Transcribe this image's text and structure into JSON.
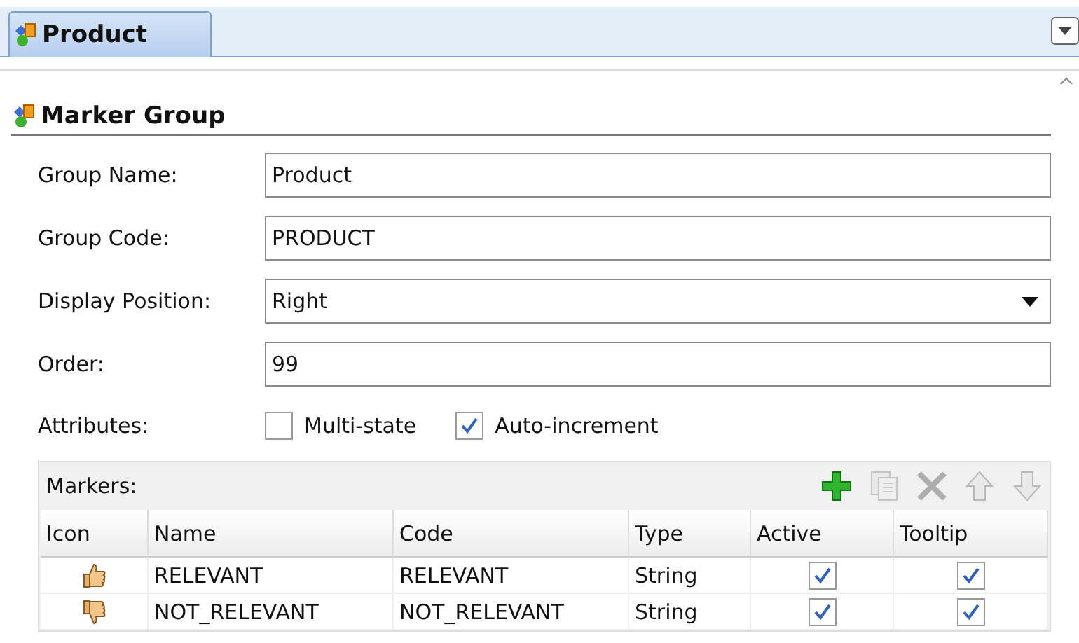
{
  "tab": {
    "label": "Product",
    "selected": true
  },
  "section": {
    "title": "Marker Group"
  },
  "fields": [
    {
      "label": "Group Name:",
      "value": "Product",
      "kind": "text"
    },
    {
      "label": "Group Code:",
      "value": "PRODUCT",
      "kind": "text"
    },
    {
      "label": "Display Position:",
      "value": "Right",
      "kind": "select"
    },
    {
      "label": "Order:",
      "value": "99",
      "kind": "text"
    }
  ],
  "attributes": {
    "label": "Attributes:",
    "options": [
      {
        "label": "Multi-state",
        "checked": false
      },
      {
        "label": "Auto-increment",
        "checked": true
      }
    ]
  },
  "markers": {
    "title": "Markers:",
    "toolbar": [
      {
        "kind": "add",
        "disabled": false
      },
      {
        "kind": "copy",
        "disabled": true
      },
      {
        "kind": "delete",
        "disabled": true
      },
      {
        "kind": "up",
        "disabled": true
      },
      {
        "kind": "down",
        "disabled": true
      }
    ],
    "columns": [
      "Icon",
      "Name",
      "Code",
      "Type",
      "Active",
      "Tooltip"
    ],
    "rows": [
      {
        "kind": "thumbs-up",
        "name": "RELEVANT",
        "code": "RELEVANT",
        "type": "String",
        "active": true,
        "tooltip": true
      },
      {
        "kind": "thumbs-down",
        "name": "NOT_RELEVANT",
        "code": "NOT_RELEVANT",
        "type": "String",
        "active": true,
        "tooltip": true
      }
    ]
  }
}
